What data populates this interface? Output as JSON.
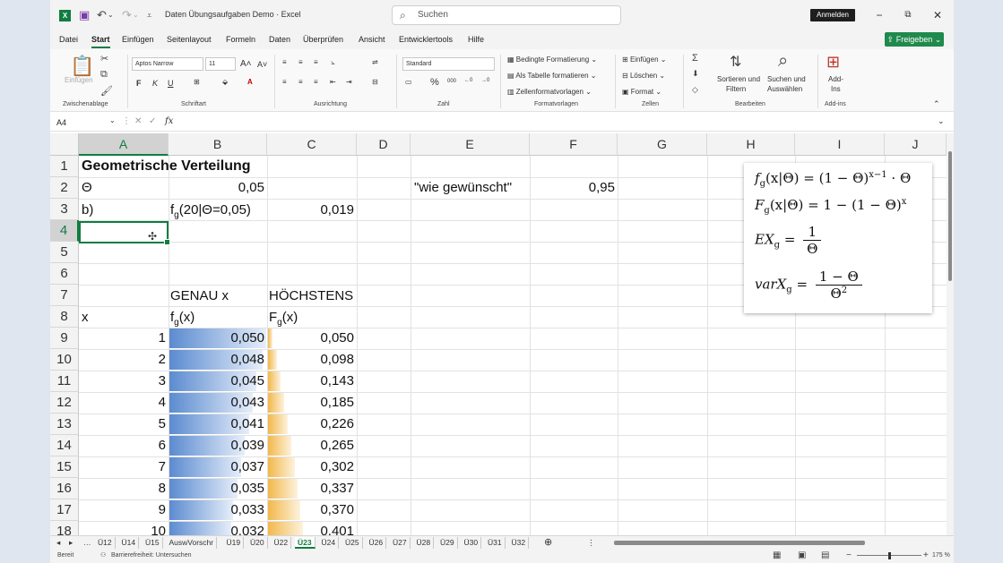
{
  "window": {
    "title": "Daten Übungsaufgaben Demo  ·  Excel",
    "search_placeholder": "Suchen",
    "sign_in": "Anmelden"
  },
  "menu": {
    "tabs": [
      "Datei",
      "Start",
      "Einfügen",
      "Seitenlayout",
      "Formeln",
      "Daten",
      "Überprüfen",
      "Ansicht",
      "Entwicklertools",
      "Hilfe"
    ],
    "active_tab": "Start",
    "share": "Freigeben"
  },
  "ribbon": {
    "clipboard_label": "Zwischenablage",
    "paste": "Einfügen",
    "font_label": "Schriftart",
    "font_name": "Aptos Narrow",
    "font_size": "11",
    "alignment_label": "Ausrichtung",
    "number_label": "Zahl",
    "number_format": "Standard",
    "styles_label": "Formatvorlagen",
    "cond_format": "Bedingte Formatierung",
    "as_table": "Als Tabelle formatieren",
    "cell_styles": "Zellenformatvorlagen",
    "cells_label": "Zellen",
    "insert": "Einfügen",
    "delete": "Löschen",
    "format": "Format",
    "editing_label": "Bearbeiten",
    "sort": "Sortieren und",
    "sort2": "Filtern",
    "find": "Suchen und",
    "find2": "Auswählen",
    "addins_label": "Add-ins",
    "addins": "Add-",
    "addins2": "Ins"
  },
  "formula_bar": {
    "name_box": "A4",
    "fx": "fx",
    "content": ""
  },
  "columns": [
    "A",
    "B",
    "C",
    "D",
    "E",
    "F",
    "G",
    "H",
    "I",
    "J"
  ],
  "rows": [
    "1",
    "2",
    "3",
    "4",
    "5",
    "6",
    "7",
    "8",
    "9",
    "10",
    "11",
    "12",
    "13",
    "14",
    "15",
    "16",
    "17",
    "18"
  ],
  "cells": {
    "a1": "Geometrische Verteilung",
    "a2": "Θ",
    "b2": "0,05",
    "a3": "b)",
    "b3": "f",
    "b3_sub": "g",
    "b3_rest": "(20|Θ=0,05)",
    "c3": "0,019",
    "e2": "\"wie gewünscht\"",
    "f2": "0,95",
    "b7": "GENAU x",
    "c7": "HÖCHSTENS",
    "a8": "x",
    "b8": "f",
    "b8_sub": "g",
    "b8_rest": "(x)",
    "c8": "F",
    "c8_sub": "g",
    "c8_rest": "(x)"
  },
  "table": {
    "x": [
      "1",
      "2",
      "3",
      "4",
      "5",
      "6",
      "7",
      "8",
      "9",
      "10"
    ],
    "pmf": [
      "0,050",
      "0,048",
      "0,045",
      "0,043",
      "0,041",
      "0,039",
      "0,037",
      "0,035",
      "0,033",
      "0,032"
    ],
    "cdf": [
      "0,050",
      "0,098",
      "0,143",
      "0,185",
      "0,226",
      "0,265",
      "0,302",
      "0,337",
      "0,370",
      "0,401"
    ],
    "pmf_values": [
      0.05,
      0.048,
      0.045,
      0.043,
      0.041,
      0.039,
      0.037,
      0.035,
      0.033,
      0.032
    ],
    "cdf_values": [
      0.05,
      0.098,
      0.143,
      0.185,
      0.226,
      0.265,
      0.302,
      0.337,
      0.37,
      0.401
    ]
  },
  "formulas": {
    "f1": "f",
    "f1_sub": "g",
    "f1_body": "(x|Θ) = (1 − Θ)",
    "f1_sup": "x−1",
    "f1_tail": " · Θ",
    "f2": "F",
    "f2_sub": "g",
    "f2_body": "(x|Θ) = 1 − (1 − Θ)",
    "f2_sup": "x",
    "f3": "EX",
    "f3_sub": "g",
    "f3_eq": " =",
    "f3_num": "1",
    "f3_den": "Θ",
    "f4": "varX",
    "f4_sub": "g",
    "f4_eq": " =",
    "f4_num": "1 − Θ",
    "f4_den": "Θ",
    "f4_den_sup": "2"
  },
  "sheets": [
    "Ü12",
    "Ü14",
    "Ü15",
    "AuswVorschr",
    "Ü19",
    "Ü20",
    "Ü22",
    "Ü23",
    "Ü24",
    "Ü25",
    "Ü26",
    "Ü27",
    "Ü28",
    "Ü29",
    "Ü30",
    "Ü31",
    "Ü32"
  ],
  "active_sheet": "Ü23",
  "statusbar": {
    "ready": "Bereit",
    "accessibility": "Barrierefreiheit: Untersuchen",
    "zoom": "175 %"
  },
  "colors": {
    "accent": "#107c41",
    "databar_blue": "#5b8bd0",
    "databar_orange": "#f2b84b"
  }
}
